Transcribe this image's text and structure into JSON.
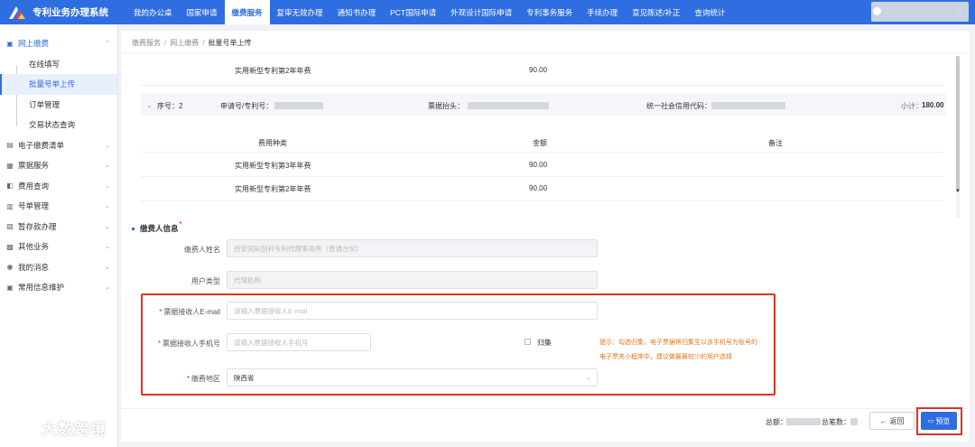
{
  "app": {
    "title": "专利业务办理系统"
  },
  "nav": {
    "items": [
      {
        "label": "我的办公桌",
        "active": false
      },
      {
        "label": "国家申请",
        "active": false
      },
      {
        "label": "缴费服务",
        "active": true
      },
      {
        "label": "复审无效办理",
        "active": false
      },
      {
        "label": "通知书办理",
        "active": false
      },
      {
        "label": "PCT国际申请",
        "active": false
      },
      {
        "label": "外观设计国际申请",
        "active": false
      },
      {
        "label": "专利事务服务",
        "active": false
      },
      {
        "label": "手续办理",
        "active": false
      },
      {
        "label": "意见陈述/补正",
        "active": false
      },
      {
        "label": "查询统计",
        "active": false
      }
    ]
  },
  "sidebar": {
    "groups": [
      {
        "label": "网上缴费",
        "icon": "wallet-icon",
        "open": true
      },
      {
        "label": "电子缴费清单",
        "icon": "list-icon"
      },
      {
        "label": "票据服务",
        "icon": "receipt-icon"
      },
      {
        "label": "费用查询",
        "icon": "search-doc-icon"
      },
      {
        "label": "号单管理",
        "icon": "doc-icon"
      },
      {
        "label": "暂存款办理",
        "icon": "deposit-icon"
      },
      {
        "label": "其他业务",
        "icon": "grid-icon"
      },
      {
        "label": "我的消息",
        "icon": "message-icon"
      },
      {
        "label": "常用信息维护",
        "icon": "edit-icon"
      }
    ],
    "sub_items": [
      {
        "label": "在线填写",
        "active": false
      },
      {
        "label": "批量号单上传",
        "active": true
      },
      {
        "label": "订单管理",
        "active": false
      },
      {
        "label": "交易状态查询",
        "active": false
      }
    ]
  },
  "breadcrumb": [
    "缴费服务",
    "网上缴费",
    "批量号单上传"
  ],
  "fees_top": {
    "fee_type": "实用新型专利第2年年费",
    "amount": "90.00"
  },
  "group2": {
    "seq_label": "序号：",
    "seq_value": "2",
    "app_no_label": "申请号/专利号：",
    "invoice_title_label": "票据抬头：",
    "credit_code_label": "统一社会信用代码：",
    "subtotal_label": "小计：",
    "subtotal_value": "180.00"
  },
  "fee_table": {
    "headers": [
      "费用种类",
      "金额",
      "备注"
    ],
    "rows": [
      {
        "fee_type": "实用新型专利第3年年费",
        "amount": "90.00"
      },
      {
        "fee_type": "实用新型专利第2年年费",
        "amount": "90.00"
      }
    ]
  },
  "payer_section": {
    "title": "缴费人信息"
  },
  "form": {
    "payer_name_label": "缴费人姓名",
    "payer_name_value": "西安国知创科专利代理事务所（普通合伙）",
    "user_type_label": "用户类型",
    "user_type_value": "代理机构",
    "email_label": "票据接收人E-mail",
    "email_placeholder": "请输入票据接收人E-mail",
    "phone_label": "票据接收人手机号",
    "phone_placeholder": "请输入票据接收人手机号",
    "collect_label": "归集",
    "hint_line1": "提示：勾选归集，电子票据将归集至以该手机号为账号的",
    "hint_line2": "电子票夹小程序中，建议做最最较少的用户选择",
    "region_label": "缴费地区",
    "region_value": "陕西省"
  },
  "footer": {
    "total_label": "总额：",
    "count_label": "总笔数：",
    "back_label": "返回",
    "preview_label": "预览"
  },
  "watermark": {
    "text": "大数跨境"
  },
  "colors": {
    "primary": "#2f6ee0",
    "highlight": "#e03222",
    "hint": "#e0761f",
    "required": "#e02e24"
  }
}
